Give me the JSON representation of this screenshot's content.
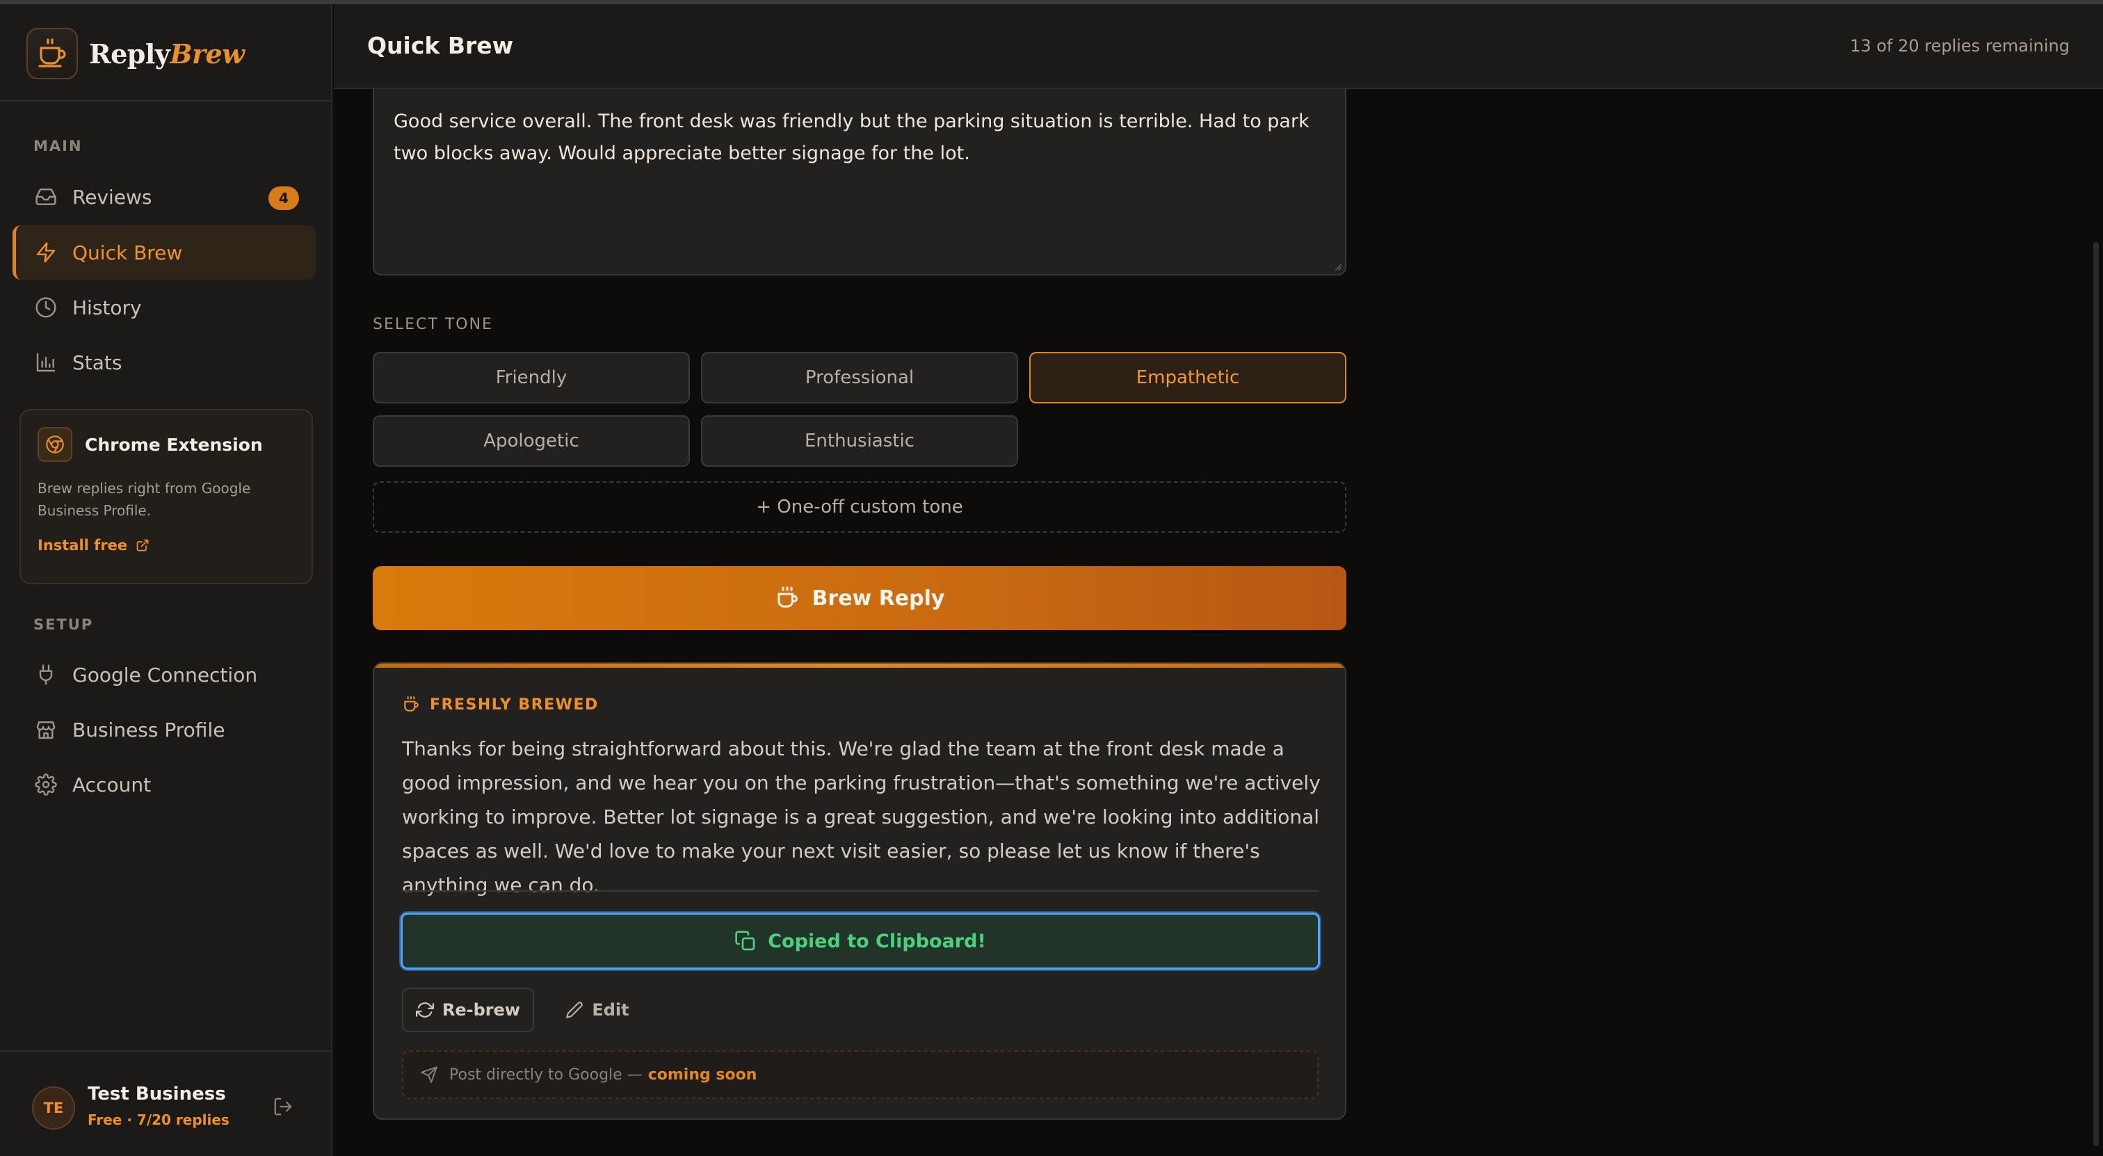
{
  "app": {
    "brand_part1": "Reply",
    "brand_part2": "Brew",
    "accent_color": "#e0821f"
  },
  "sidebar": {
    "main_label": "MAIN",
    "main_items": [
      {
        "label": "Reviews",
        "icon": "inbox-icon",
        "badge": "4"
      },
      {
        "label": "Quick Brew",
        "icon": "lightning-icon",
        "active": true
      },
      {
        "label": "History",
        "icon": "clock-icon"
      },
      {
        "label": "Stats",
        "icon": "bar-chart-icon"
      }
    ],
    "extension": {
      "title": "Chrome Extension",
      "description": "Brew replies right from Google Business Profile.",
      "link": "Install free"
    },
    "setup_label": "SETUP",
    "setup_items": [
      {
        "label": "Google Connection",
        "icon": "plug-icon"
      },
      {
        "label": "Business Profile",
        "icon": "store-icon"
      },
      {
        "label": "Account",
        "icon": "gear-icon"
      }
    ],
    "user": {
      "initials": "TE",
      "name": "Test Business",
      "plan": "Free · 7/20 replies"
    }
  },
  "header": {
    "title": "Quick Brew",
    "remaining": "13 of 20 replies remaining"
  },
  "main": {
    "review_text": "Good service overall. The front desk was friendly but the parking situation is terrible. Had to park two blocks away. Would appreciate better signage for the lot.",
    "tone_label": "SELECT TONE",
    "tones": [
      "Friendly",
      "Professional",
      "Empathetic",
      "Apologetic",
      "Enthusiastic"
    ],
    "selected_tone": "Empathetic",
    "custom_tone": "+ One-off custom tone",
    "brew_button": "Brew Reply",
    "result": {
      "label": "FRESHLY BREWED",
      "reply": "Thanks for being straightforward about this. We're glad the team at the front desk made a good impression, and we hear you on the parking frustration—that's something we're actively working to improve. Better lot signage is a great suggestion, and we're looking into additional spaces as well. We'd love to make your next visit easier, so please let us know if there's anything we can do.",
      "copied_button": "Copied to Clipboard!",
      "rebrew_button": "Re-brew",
      "edit_button": "Edit",
      "post_text": "Post directly to Google —",
      "post_soon": "coming soon"
    }
  }
}
